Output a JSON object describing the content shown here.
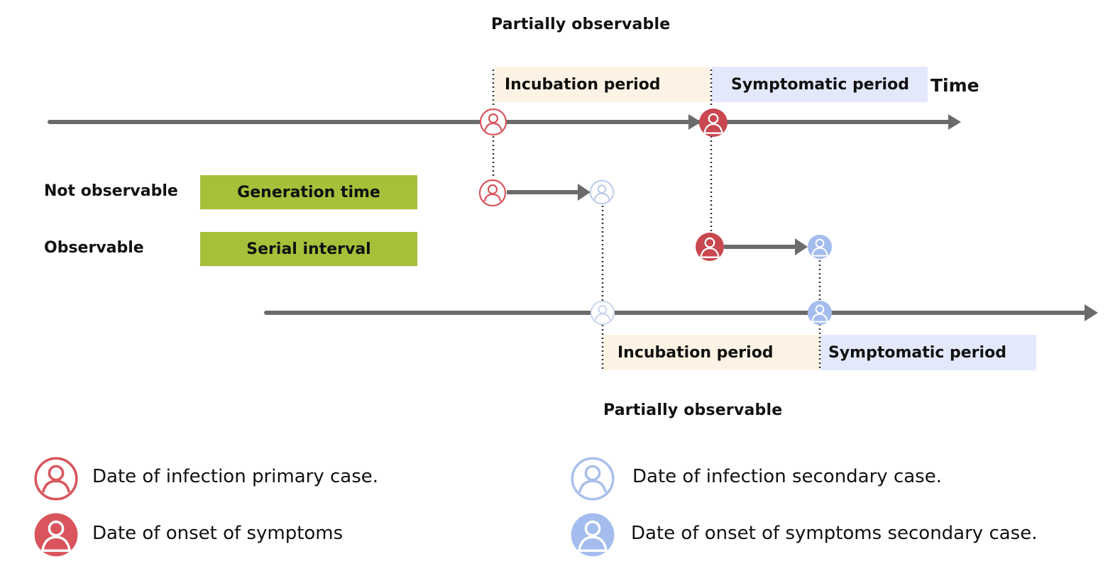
{
  "top_observability": "Partially observable",
  "bottom_observability": "Partially observable",
  "time_label": "Time",
  "primary_timeline": {
    "incubation_label": "Incubation period",
    "symptomatic_label": "Symptomatic period"
  },
  "secondary_timeline": {
    "incubation_label": "Incubation period",
    "symptomatic_label": "Symptomatic period"
  },
  "intervals": [
    {
      "observability": "Not observable",
      "label": "Generation time"
    },
    {
      "observability": "Observable",
      "label": "Serial interval"
    }
  ],
  "legend": [
    {
      "icon": "person-outline-icon",
      "label": "Date of infection primary case."
    },
    {
      "icon": "person-filled-icon",
      "label": "Date of onset of symptoms"
    },
    {
      "icon": "person-outline-icon",
      "label": "Date of infection secondary case."
    },
    {
      "icon": "person-filled-icon",
      "label": "Date of onset of symptoms secondary case."
    }
  ],
  "colors": {
    "primary": "#d9545c",
    "primary_filled": "#c9474f",
    "secondary_outline": "#a9c0ea",
    "secondary_filled": "#a4bdee",
    "green": "#a5c13a",
    "incubation_bg": "#fdf3e4",
    "symptomatic_bg": "#e3e9fb",
    "axis": "#6b6b6b"
  }
}
